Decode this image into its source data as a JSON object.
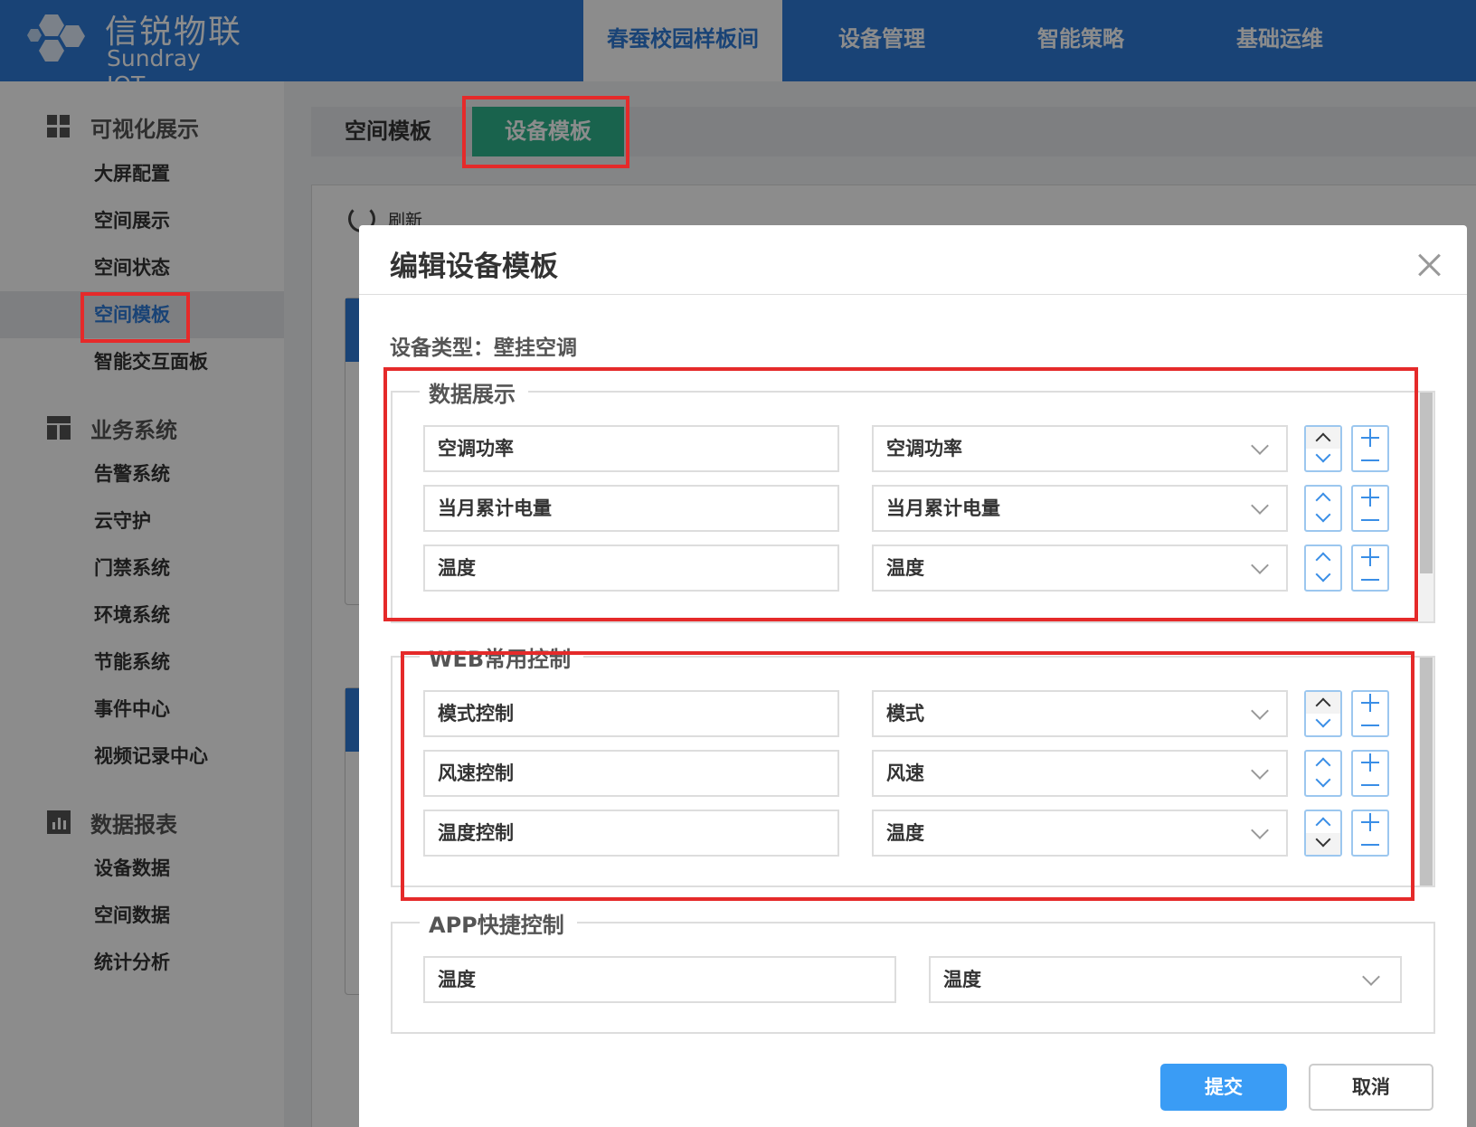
{
  "brand": {
    "name_cn": "信锐物联",
    "name_en": "Sundray IOT"
  },
  "topnav": [
    {
      "label": "春蚕校园样板间",
      "active": true
    },
    {
      "label": "设备管理"
    },
    {
      "label": "智能策略"
    },
    {
      "label": "基础运维"
    }
  ],
  "sidebar": {
    "groups": [
      {
        "label": "可视化展示",
        "icon": "dashboard-icon"
      },
      {
        "label": "业务系统",
        "icon": "business-icon"
      },
      {
        "label": "数据报表",
        "icon": "report-icon"
      }
    ],
    "items": [
      {
        "label": "大屏配置"
      },
      {
        "label": "空间展示"
      },
      {
        "label": "空间状态"
      },
      {
        "label": "空间模板",
        "active": true
      },
      {
        "label": "智能交互面板"
      },
      {
        "label": "告警系统"
      },
      {
        "label": "云守护"
      },
      {
        "label": "门禁系统"
      },
      {
        "label": "环境系统"
      },
      {
        "label": "节能系统"
      },
      {
        "label": "事件中心"
      },
      {
        "label": "视频记录中心"
      },
      {
        "label": "设备数据"
      },
      {
        "label": "空间数据"
      },
      {
        "label": "统计分析"
      }
    ]
  },
  "tabs": {
    "space": "空间模板",
    "device": "设备模板"
  },
  "panel": {
    "refresh": "刷新"
  },
  "modal": {
    "title": "编辑设备模板",
    "device_type": "设备类型：壁挂空调",
    "data_display": {
      "legend": "数据展示",
      "rows": [
        {
          "name": "空调功率",
          "field": "空调功率"
        },
        {
          "name": "当月累计电量",
          "field": "当月累计电量"
        },
        {
          "name": "温度",
          "field": "温度"
        }
      ]
    },
    "web_control": {
      "legend": "WEB常用控制",
      "rows": [
        {
          "name": "模式控制",
          "field": "模式"
        },
        {
          "name": "风速控制",
          "field": "风速"
        },
        {
          "name": "温度控制",
          "field": "温度"
        }
      ]
    },
    "app_control": {
      "legend": "APP快捷控制",
      "rows": [
        {
          "name": "温度",
          "field": "温度"
        }
      ]
    },
    "submit": "提交",
    "cancel": "取消"
  },
  "colors": {
    "primary": "#2e7bd8",
    "tab_active": "#2fb58d",
    "highlight": "#e52a2a",
    "submit": "#3a9cf5"
  }
}
